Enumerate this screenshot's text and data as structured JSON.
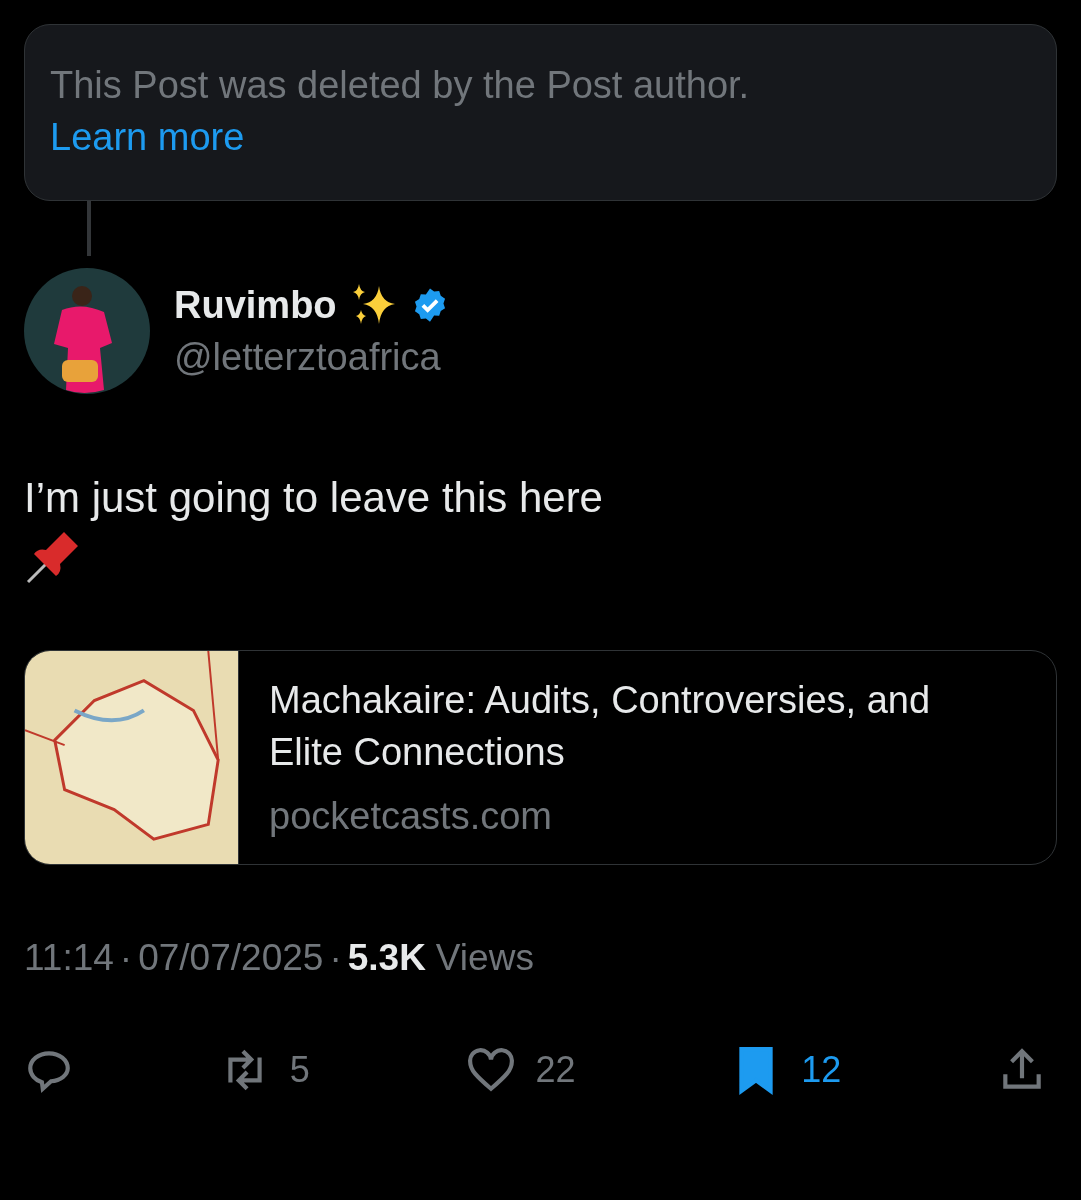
{
  "deleted_notice": {
    "text": "This Post was deleted by the Post author.",
    "link": "Learn more"
  },
  "author": {
    "name": "Ruvimbo",
    "verified": true,
    "handle": "@letterztoafrica"
  },
  "post": {
    "text": "I’m just going to leave this here"
  },
  "link_card": {
    "title": "Machakaire: Audits, Controversies, and Elite Connections",
    "domain": "pocketcasts.com"
  },
  "meta": {
    "time": "11:14",
    "separator_1": "·",
    "date": "07/07/2025",
    "separator_2": "·",
    "views_count": "5.3K",
    "views_label": "Views"
  },
  "actions": [
    {
      "kind": "reply",
      "selected": false
    },
    {
      "kind": "repost",
      "count": "5",
      "selected": false
    },
    {
      "kind": "like",
      "count": "22",
      "selected": false
    },
    {
      "kind": "bookmark",
      "count": "12",
      "selected": true
    },
    {
      "kind": "share",
      "selected": false
    }
  ]
}
